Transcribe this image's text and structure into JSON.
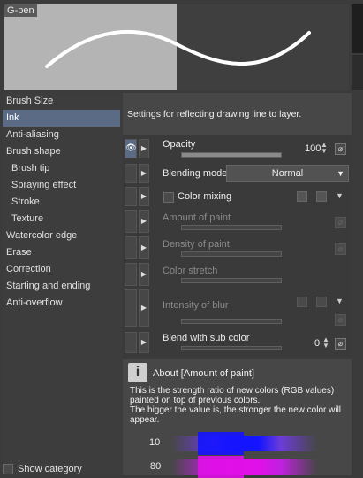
{
  "preview": {
    "label": "G-pen"
  },
  "categories": [
    {
      "label": "Brush Size",
      "sub": false,
      "selected": false
    },
    {
      "label": "Ink",
      "sub": false,
      "selected": true
    },
    {
      "label": "Anti-aliasing",
      "sub": false,
      "selected": false
    },
    {
      "label": "Brush shape",
      "sub": false,
      "selected": false
    },
    {
      "label": "Brush tip",
      "sub": true,
      "selected": false
    },
    {
      "label": "Spraying effect",
      "sub": true,
      "selected": false
    },
    {
      "label": "Stroke",
      "sub": true,
      "selected": false
    },
    {
      "label": "Texture",
      "sub": true,
      "selected": false
    },
    {
      "label": "Watercolor edge",
      "sub": false,
      "selected": false
    },
    {
      "label": "Erase",
      "sub": false,
      "selected": false
    },
    {
      "label": "Correction",
      "sub": false,
      "selected": false
    },
    {
      "label": "Starting and ending",
      "sub": false,
      "selected": false
    },
    {
      "label": "Anti-overflow",
      "sub": false,
      "selected": false
    }
  ],
  "show_category": {
    "label": "Show category"
  },
  "panel": {
    "description": "Settings for reflecting drawing line to layer.",
    "opacity": {
      "label": "Opacity",
      "value": "100",
      "slider_fraction": 1.0
    },
    "blending_mode": {
      "label": "Blending mode",
      "value": "Normal"
    },
    "color_mixing": {
      "label": "Color mixing"
    },
    "amount_of_paint": {
      "label": "Amount of paint"
    },
    "density_of_paint": {
      "label": "Density of paint"
    },
    "color_stretch": {
      "label": "Color stretch"
    },
    "intensity_of_blur": {
      "label": "Intensity of blur"
    },
    "blend_with_sub_color": {
      "label": "Blend with sub color",
      "value": "0"
    }
  },
  "about": {
    "icon": "i",
    "title": "About [Amount of paint]",
    "description": "This is the strength ratio of new colors (RGB values) painted on top of previous colors.\n The bigger the value is, the stronger the new color will appear.",
    "examples": [
      {
        "value": "10",
        "color": "#1414ff",
        "base": "#6c3cd8"
      },
      {
        "value": "80",
        "color": "#e010e8",
        "base": "#c020e0"
      }
    ]
  }
}
